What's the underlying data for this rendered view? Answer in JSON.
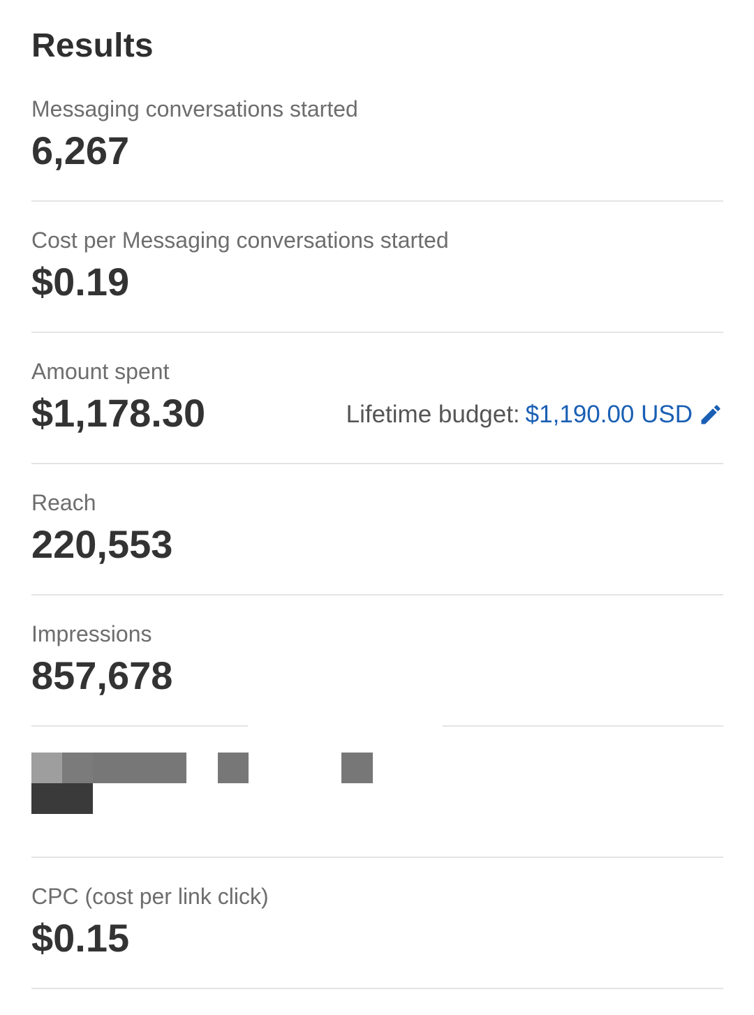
{
  "header": {
    "title": "Results"
  },
  "metrics": [
    {
      "label": "Messaging conversations started",
      "value": "6,267"
    },
    {
      "label": "Cost per Messaging conversations started",
      "value": "$0.19"
    },
    {
      "label": "Amount spent",
      "value": "$1,178.30",
      "budget": {
        "label": "Lifetime budget:",
        "value": "$1,190.00 USD",
        "icon": "pencil-edit-icon"
      }
    },
    {
      "label": "Reach",
      "value": "220,553"
    },
    {
      "label": "Impressions",
      "value": "857,678"
    },
    {
      "label": "CPC (cost per link click)",
      "value": "$0.15"
    }
  ],
  "colors": {
    "link": "#1a5fb4",
    "divider": "#e4e4e4",
    "redaction_dark": "#3a3a3a",
    "redaction_mid": "#777777",
    "redaction_light": "#9e9e9e"
  }
}
